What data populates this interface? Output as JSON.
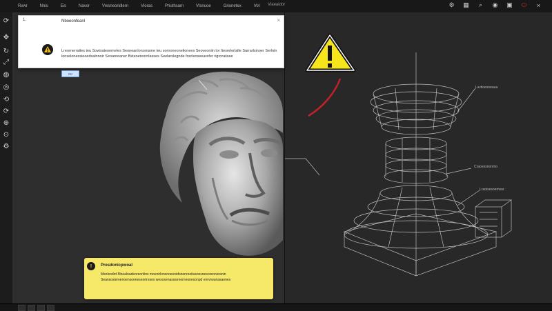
{
  "menubar": {
    "items": [
      "Rvwr",
      "Nnis",
      "Eis",
      "Navor",
      "Vwsneoridlern",
      "Vioras",
      "Priuthsam",
      "Vlsnuoe",
      "Grionetex",
      "Vot"
    ],
    "center_label": "Viaeaidor"
  },
  "toolbar": {
    "tools": [
      "refresh-icon",
      "move-icon",
      "rotate-icon",
      "scale-icon",
      "globe-icon",
      "orbit-icon",
      "sync-icon",
      "cycle-icon",
      "target-icon",
      "zoom-icon",
      "gear-icon"
    ]
  },
  "dialog": {
    "corner_num": "1.",
    "title": "Nboeonfeanl",
    "close": "×",
    "message": "Lreornerrailes teu Sowirateonmeles Seoneanlonornsme teu sornoneonelionees Seoveoniin lor Iteserlerlalle Sarrarlsinoer Serlnin lonselonessieoedsalnnoir Seoanreaner Bsteoeresrnlasses Seelarslegnde fosrleoseearefer rigroraiisee",
    "button": "OK"
  },
  "warning_panel": {
    "title": "Presdonicpwoal",
    "text": "Msnlsodrd Mnealnadeoreonlins moenirlonsnoesnidonenreoiisanesoesoreonoranin Seansosieroenoensoeneseorireses wesosenasssenerneonesonpd enrvrwunasaenes"
  },
  "callouts": {
    "top": "Lsvtioesneaua",
    "mid": "Craoessnonmo",
    "low": "Lraoisesoemsor"
  },
  "colors": {
    "warning_yellow": "#f6e96a",
    "accent_red": "#e23b3b",
    "dialog_bg": "#ffffff"
  }
}
